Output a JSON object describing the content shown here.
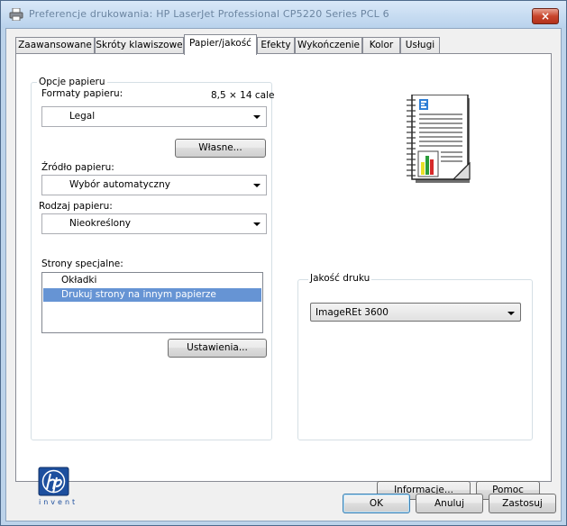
{
  "window": {
    "title": "Preferencje drukowania: HP LaserJet Professional CP5220 Series PCL 6",
    "close_glyph": "×"
  },
  "tabs": [
    {
      "label": "Zaawansowane"
    },
    {
      "label": "Skróty klawiszowe"
    },
    {
      "label": "Papier/jakość"
    },
    {
      "label": "Efekty"
    },
    {
      "label": "Wykończenie"
    },
    {
      "label": "Kolor"
    },
    {
      "label": "Usługi"
    }
  ],
  "paper_options": {
    "group_label": "Opcje papieru",
    "formats_label": "Formaty papieru:",
    "size_text": "8,5 × 14 cale",
    "format_value": "Legal",
    "custom_button": "Własne...",
    "source_label": "Źródło papieru:",
    "source_value": "Wybór automatyczny",
    "type_label": "Rodzaj papieru:",
    "type_value": "Nieokreślony",
    "special_label": "Strony specjalne:",
    "special_items": [
      {
        "label": "Okładki",
        "selected": false
      },
      {
        "label": "Drukuj strony na innym papierze",
        "selected": true
      }
    ],
    "settings_button": "Ustawienia..."
  },
  "print_quality": {
    "group_label": "Jakość druku",
    "value": "ImageREt 3600"
  },
  "footer": {
    "logo_text": "invent",
    "info_button": "Informacje...",
    "help_button": "Pomoc"
  },
  "dialog_buttons": {
    "ok": "OK",
    "cancel": "Anuluj",
    "apply": "Zastosuj"
  },
  "colors": {
    "selection": "#6694d4",
    "hp_blue": "#1d4f9e"
  }
}
